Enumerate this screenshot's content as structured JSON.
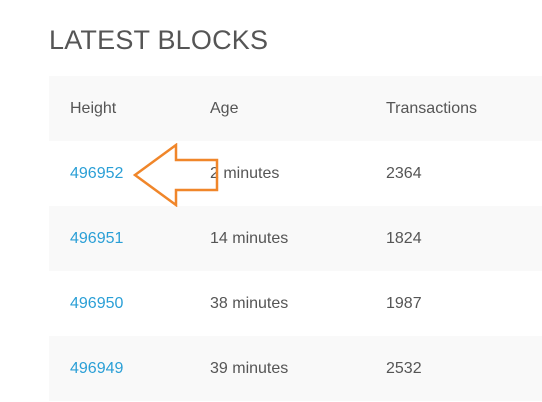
{
  "page": {
    "title": "LATEST BLOCKS"
  },
  "table": {
    "headers": {
      "height": "Height",
      "age": "Age",
      "transactions": "Transactions"
    },
    "rows": [
      {
        "height": "496952",
        "age": "2 minutes",
        "transactions": "2364"
      },
      {
        "height": "496951",
        "age": "14 minutes",
        "transactions": "1824"
      },
      {
        "height": "496950",
        "age": "38 minutes",
        "transactions": "1987"
      },
      {
        "height": "496949",
        "age": "39 minutes",
        "transactions": "2532"
      }
    ]
  },
  "annotation": {
    "icon": "arrow-left-icon",
    "color": "#f0862a"
  },
  "colors": {
    "link": "#2a9fd6",
    "text": "#555555",
    "row_shade": "#f9f9f9"
  }
}
